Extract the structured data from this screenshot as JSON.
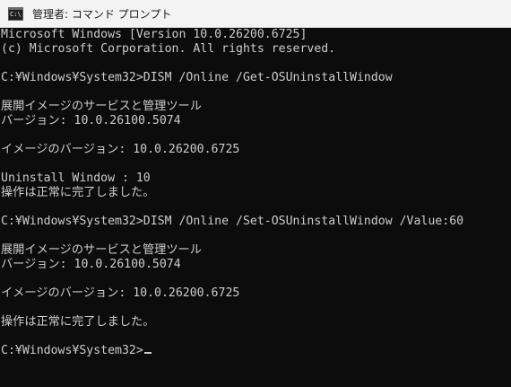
{
  "window": {
    "icon_text": "C:\\",
    "title": "管理者: コマンド プロンプト"
  },
  "console": {
    "lines": [
      "Microsoft Windows [Version 10.0.26200.6725]",
      "(c) Microsoft Corporation. All rights reserved.",
      "",
      "C:¥Windows¥System32>DISM /Online /Get-OSUninstallWindow",
      "",
      "展開イメージのサービスと管理ツール",
      "バージョン: 10.0.26100.5074",
      "",
      "イメージのバージョン: 10.0.26200.6725",
      "",
      "Uninstall Window : 10",
      "操作は正常に完了しました。",
      "",
      "C:¥Windows¥System32>DISM /Online /Set-OSUninstallWindow /Value:60",
      "",
      "展開イメージのサービスと管理ツール",
      "バージョン: 10.0.26100.5074",
      "",
      "イメージのバージョン: 10.0.26200.6725",
      "",
      "操作は正常に完了しました。",
      "",
      "C:¥Windows¥System32>"
    ]
  },
  "colors": {
    "background": "#0c0c0c",
    "text": "#cccccc",
    "titlebar": "#f3f3f3"
  }
}
